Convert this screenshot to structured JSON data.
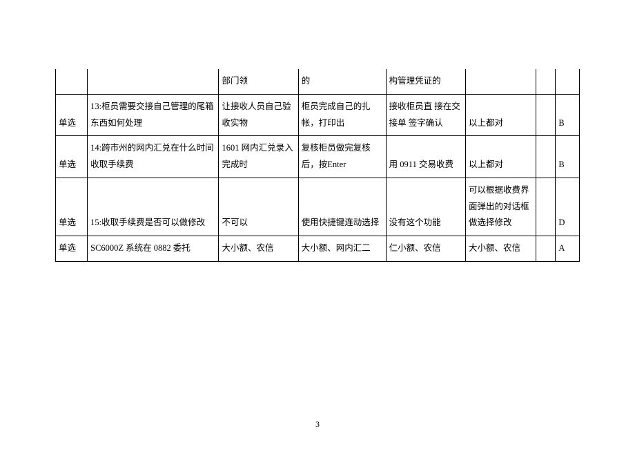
{
  "pageNumber": "3",
  "rows": [
    {
      "type": "",
      "question": "",
      "a": "部门领",
      "b": "的",
      "c": "构管理凭证的",
      "d": "",
      "e": "",
      "ans": ""
    },
    {
      "type": "单选",
      "question": "13:柜员需要交接自己管理的尾箱东西如何处理",
      "a": "让接收人员自己验收实物",
      "b": "柜员完成自己的扎帐，打印出",
      "c": "接收柜员直 接在交接单 签字确认",
      "d": "以上都对",
      "e": "",
      "ans": "B"
    },
    {
      "type": "单选",
      "question": "14:跨市州的网内汇兑在什么时间收取手续费",
      "a": "1601 网内汇兑录入完成时",
      "b": "复核柜员做完复核后，按Enter",
      "c": "用 0911 交易收费",
      "d": "以上都对",
      "e": "",
      "ans": "B"
    },
    {
      "type": "单选",
      "question": "15:收取手续费是否可以做修改",
      "a": "不可以",
      "b": "使用快捷键连动选择",
      "c": "没有这个功能",
      "d": "可以根据收费界面弹出的对话框做选择修改",
      "e": "",
      "ans": "D"
    },
    {
      "type": "单选",
      "question": "SC6000Z 系统在 0882 委托",
      "a": "大小额、农信",
      "b": "大小额、网内汇二",
      "c": "仁小额、农信",
      "d": "大小额、农信",
      "e": "",
      "ans": "A"
    }
  ]
}
